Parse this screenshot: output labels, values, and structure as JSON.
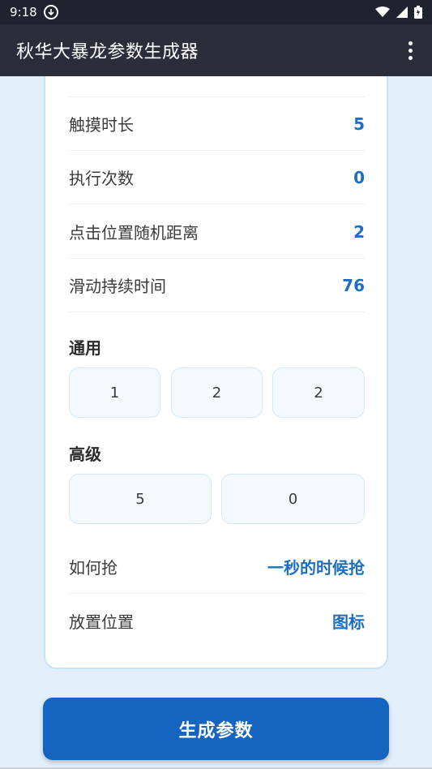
{
  "status_bar": {
    "time": "9:18"
  },
  "app_bar": {
    "title": "秋华大暴龙参数生成器"
  },
  "rows": [
    {
      "label": "触摸时长",
      "value": "5"
    },
    {
      "label": "执行次数",
      "value": "0"
    },
    {
      "label": "点击位置随机距离",
      "value": "2"
    },
    {
      "label": "滑动持续时间",
      "value": "76"
    }
  ],
  "general": {
    "title": "通用",
    "values": [
      "1",
      "2",
      "2"
    ]
  },
  "advanced": {
    "title": "高级",
    "values": [
      "5",
      "0"
    ]
  },
  "options": [
    {
      "label": "如何抢",
      "value": "一秒的时候抢"
    },
    {
      "label": "放置位置",
      "value": "图标"
    }
  ],
  "button": {
    "label": "生成参数"
  }
}
